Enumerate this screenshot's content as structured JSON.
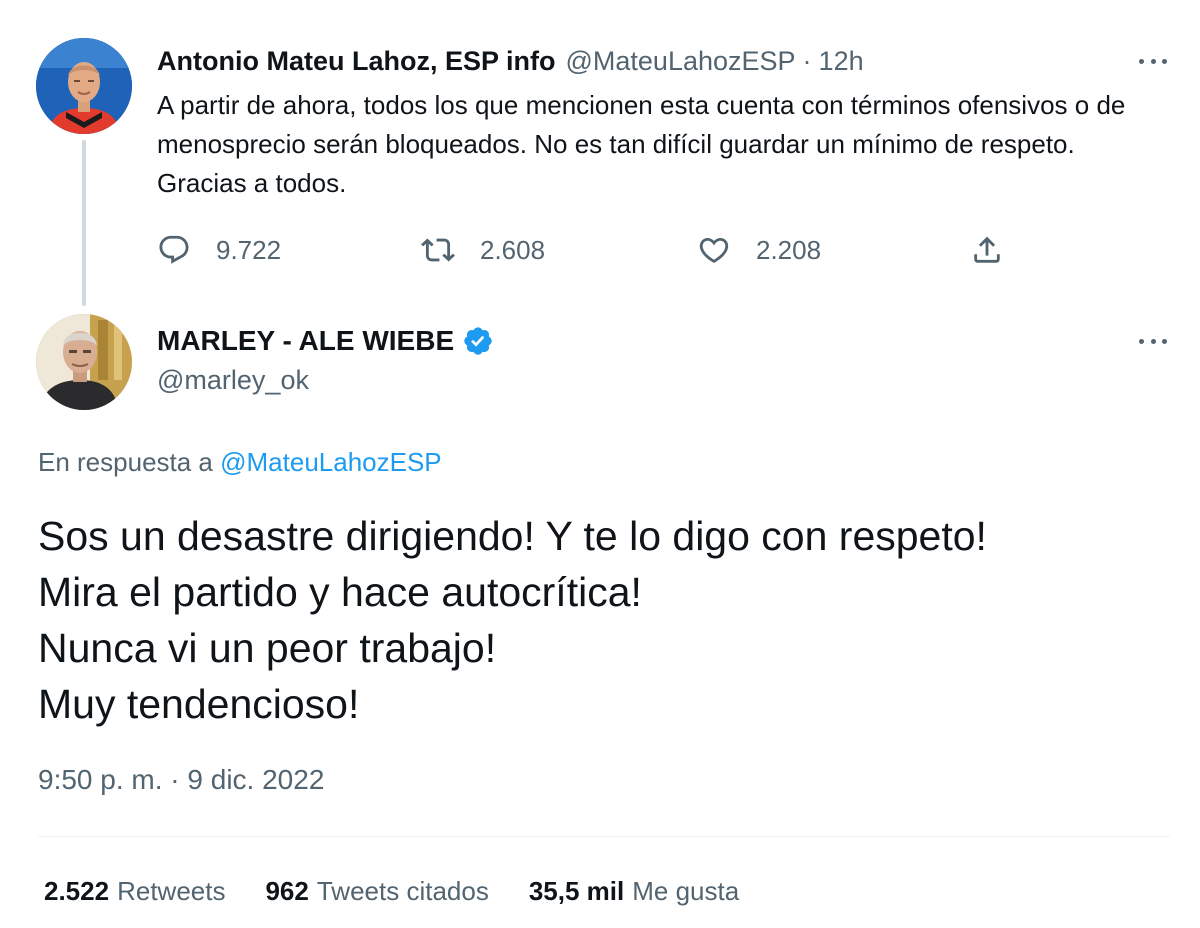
{
  "parent_tweet": {
    "author_name": "Antonio Mateu Lahoz, ESP info",
    "handle": "@MateuLahozESP",
    "separator": "·",
    "time_ago": "12h",
    "text": "A partir de ahora, todos los que mencionen esta cuenta con términos ofensivos o de menosprecio serán bloqueados. No es tan difícil guardar un mínimo de respeto. Gracias a todos.",
    "replies": "9.722",
    "retweets": "2.608",
    "likes": "2.208"
  },
  "reply_tweet": {
    "author_name": "MARLEY - ALE WIEBE",
    "handle": "@marley_ok",
    "in_reply_to_label": "En respuesta a",
    "in_reply_to_handle": "@MateuLahozESP",
    "lines": [
      "Sos un desastre dirigiendo! Y te lo digo con respeto!",
      "Mira el partido y hace autocrítica!",
      "Nunca vi un peor trabajo!",
      "Muy tendencioso!"
    ],
    "timestamp": "9:50 p. m. · 9 dic. 2022",
    "stats": {
      "retweets_count": "2.522",
      "retweets_label": "Retweets",
      "quotes_count": "962",
      "quotes_label": "Tweets citados",
      "likes_count": "35,5 mil",
      "likes_label": "Me gusta"
    }
  },
  "icons": {
    "reply": "reply-icon",
    "retweet": "retweet-icon",
    "like": "heart-icon",
    "share": "share-icon",
    "more": "more-options-icon",
    "verified": "verified-badge-icon"
  },
  "colors": {
    "text_primary": "#0f1419",
    "text_secondary": "#536471",
    "link": "#1d9bf0",
    "verified": "#1d9bf0",
    "thread_line": "#cfd9de"
  }
}
